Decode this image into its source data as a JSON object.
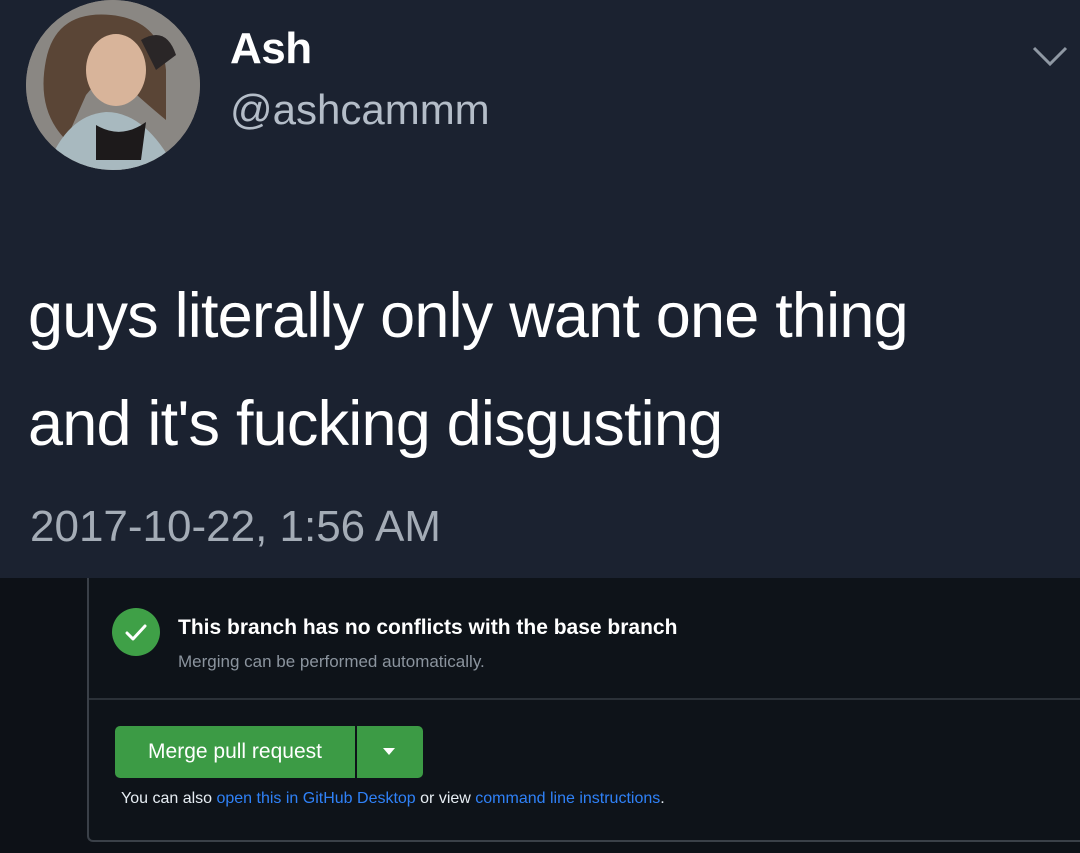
{
  "tweet": {
    "display_name": "Ash",
    "handle": "@ashcammm",
    "text_line1": "guys literally only want one thing",
    "text_line2": "and it's fucking disgusting",
    "timestamp": "2017-10-22, 1:56 AM"
  },
  "merge": {
    "status_title": "This branch has no conflicts with the base branch",
    "status_subtitle": "Merging can be performed automatically.",
    "merge_button_label": "Merge pull request",
    "help_prefix": "You can also ",
    "help_link1": "open this in GitHub Desktop",
    "help_middle": " or view ",
    "help_link2": "command line instructions",
    "help_suffix": "."
  },
  "colors": {
    "tweet_bg": "#1b2230",
    "page_bg": "#0d1117",
    "success_green": "#3fa047",
    "merge_green": "#3c9b45",
    "link_blue": "#2f81f7"
  },
  "icons": {
    "chevron": "chevron-down-icon",
    "check": "check-icon",
    "caret": "caret-down-icon"
  }
}
